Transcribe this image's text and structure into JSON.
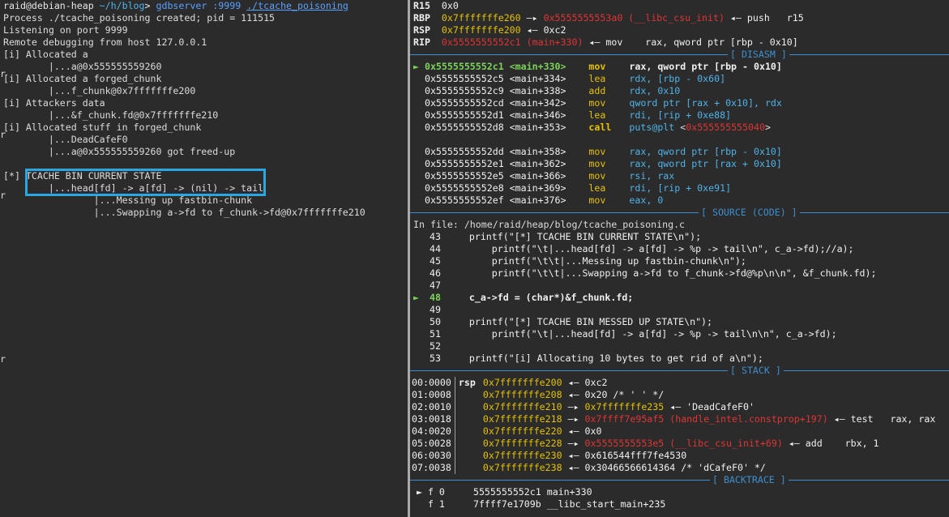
{
  "left": {
    "prompt_user": "raid@debian-heap",
    "prompt_path": "~/h/blog",
    "prompt_sym": "> ",
    "cmd": "gdbserver",
    "cmd_port": " :9999",
    "cmd_arg": "./tcache_poisoning",
    "lines": [
      "Process ./tcache_poisoning created; pid = 111515",
      "Listening on port 9999",
      "Remote debugging from host 127.0.0.1",
      "[i] Allocated a",
      "        |...a@0x555555559260",
      "[i] Allocated a forged_chunk",
      "        |...f_chunk@0x7fffffffe200",
      "[i] Attackers data",
      "        |...&f_chunk.fd@0x7fffffffe210",
      "[i] Allocated stuff in forged_chunk",
      "        |...DeadCafeF0",
      "        |...a@0x555555559260 got freed-up",
      "",
      "[*] TCACHE BIN CURRENT STATE",
      "        |...head[fd] -> a[fd] -> (nil) -> tail",
      "                |...Messing up fastbin-chunk",
      "                |...Swapping a->fd to f_chunk->fd@0x7fffffffe210"
    ],
    "stray_char": "r"
  },
  "regs": [
    {
      "name": "R15",
      "addr": "",
      "rest": "0x0"
    },
    {
      "name": "RBP",
      "addr": "0x7fffffffe260",
      "arrow": " —▸ ",
      "target": "0x5555555553a0 (__libc_csu_init)",
      "rest2": " ◂— push   r15"
    },
    {
      "name": "RSP",
      "addr": "0x7fffffffe200",
      "arrow": " ◂— ",
      "rest2": "0xc2"
    },
    {
      "name": "RIP",
      "addr": "0x5555555552c1 (main+330)",
      "arrow": " ◂— ",
      "rest2": "mov    rax, qword ptr [rbp - 0x10]"
    }
  ],
  "sections": {
    "disasm": "[ DISASM ]",
    "source": "[ SOURCE (CODE) ]",
    "stack": "[ STACK ]",
    "backtrace": "[ BACKTRACE ]"
  },
  "disasm": [
    {
      "cur": true,
      "addr": "0x5555555552c1",
      "sym": "<main+330>",
      "op": "mov",
      "args": "rax, qword ptr [rbp - 0x10]"
    },
    {
      "addr": "0x5555555552c5",
      "sym": "<main+334>",
      "op": "lea",
      "args": "rdx, [rbp - 0x60]"
    },
    {
      "addr": "0x5555555552c9",
      "sym": "<main+338>",
      "op": "add",
      "args": "rdx, 0x10"
    },
    {
      "addr": "0x5555555552cd",
      "sym": "<main+342>",
      "op": "mov",
      "args": "qword ptr [rax + 0x10], rdx"
    },
    {
      "addr": "0x5555555552d1",
      "sym": "<main+346>",
      "op": "lea",
      "args": "rdi, [rip + 0xe88]"
    },
    {
      "addr": "0x5555555552d8",
      "sym": "<main+353>",
      "op": "call",
      "args": "puts@plt",
      "target": "<0x555555555040>"
    },
    {
      "blank": true
    },
    {
      "addr": "0x5555555552dd",
      "sym": "<main+358>",
      "op": "mov",
      "args": "rax, qword ptr [rbp - 0x10]"
    },
    {
      "addr": "0x5555555552e1",
      "sym": "<main+362>",
      "op": "mov",
      "args": "rax, qword ptr [rax + 0x10]"
    },
    {
      "addr": "0x5555555552e5",
      "sym": "<main+366>",
      "op": "mov",
      "args": "rsi, rax"
    },
    {
      "addr": "0x5555555552e8",
      "sym": "<main+369>",
      "op": "lea",
      "args": "rdi, [rip + 0xe91]"
    },
    {
      "addr": "0x5555555552ef",
      "sym": "<main+376>",
      "op": "mov",
      "args": "eax, 0"
    }
  ],
  "source": {
    "file_label": "In file: /home/raid/heap/blog/tcache_poisoning.c",
    "lines": [
      {
        "n": "43",
        "code": "     printf(\"[*] TCACHE BIN CURRENT STATE\\n\");"
      },
      {
        "n": "44",
        "code": "         printf(\"\\t|...head[fd] -> a[fd] -> %p -> tail\\n\", c_a->fd);//a);"
      },
      {
        "n": "45",
        "code": "         printf(\"\\t\\t|...Messing up fastbin-chunk\\n\");"
      },
      {
        "n": "46",
        "code": "         printf(\"\\t\\t|...Swapping a->fd to f_chunk->fd@%p\\n\\n\", &f_chunk.fd);"
      },
      {
        "n": "47",
        "code": ""
      },
      {
        "n": "48",
        "code": "     c_a->fd = (char*)&f_chunk.fd;",
        "cur": true
      },
      {
        "n": "49",
        "code": ""
      },
      {
        "n": "50",
        "code": "     printf(\"[*] TCACHE BIN MESSED UP STATE\\n\");"
      },
      {
        "n": "51",
        "code": "         printf(\"\\t|...head[fd] -> a[fd] -> %p -> tail\\n\\n\", c_a->fd);"
      },
      {
        "n": "52",
        "code": ""
      },
      {
        "n": "53",
        "code": "     printf(\"[i] Allocating 10 bytes to get rid of a\\n\");"
      }
    ]
  },
  "stack": [
    {
      "idx": "00:0000",
      "reg": "rsp",
      "addr": "0x7fffffffe200",
      "arrow": " ◂— ",
      "val": "0xc2"
    },
    {
      "idx": "01:0008",
      "reg": "",
      "addr": "0x7fffffffe208",
      "arrow": " ◂— ",
      "val": "0x20 /* ' ' */"
    },
    {
      "idx": "02:0010",
      "reg": "",
      "addr": "0x7fffffffe210",
      "arrow": " —▸ ",
      "val2": "0x7fffffffe235",
      "val3": " ◂— 'DeadCafeF0'"
    },
    {
      "idx": "03:0018",
      "reg": "",
      "addr": "0x7fffffffe218",
      "arrow": " —▸ ",
      "red": "0x7ffff7e95af5 (handle_intel.constprop+197)",
      "val3": " ◂— test   rax, rax"
    },
    {
      "idx": "04:0020",
      "reg": "",
      "addr": "0x7fffffffe220",
      "arrow": " ◂— ",
      "val": "0x0"
    },
    {
      "idx": "05:0028",
      "reg": "",
      "addr": "0x7fffffffe228",
      "arrow": " —▸ ",
      "red": "0x5555555553e5 (__libc_csu_init+69)",
      "val3": " ◂— add    rbx, 1"
    },
    {
      "idx": "06:0030",
      "reg": "",
      "addr": "0x7fffffffe230",
      "arrow": " ◂— ",
      "val": "0x616544fff7fe4530"
    },
    {
      "idx": "07:0038",
      "reg": "",
      "addr": "0x7fffffffe238",
      "arrow": " ◂— ",
      "val": "0x30466566614364 /* 'dCafeF0' */"
    }
  ],
  "backtrace": [
    {
      "cur": true,
      "frame": "f 0",
      "addr": "5555555552c1",
      "sym": "main+330"
    },
    {
      "frame": "f 1",
      "addr": "7ffff7e1709b",
      "sym": "__libc_start_main+235"
    }
  ]
}
